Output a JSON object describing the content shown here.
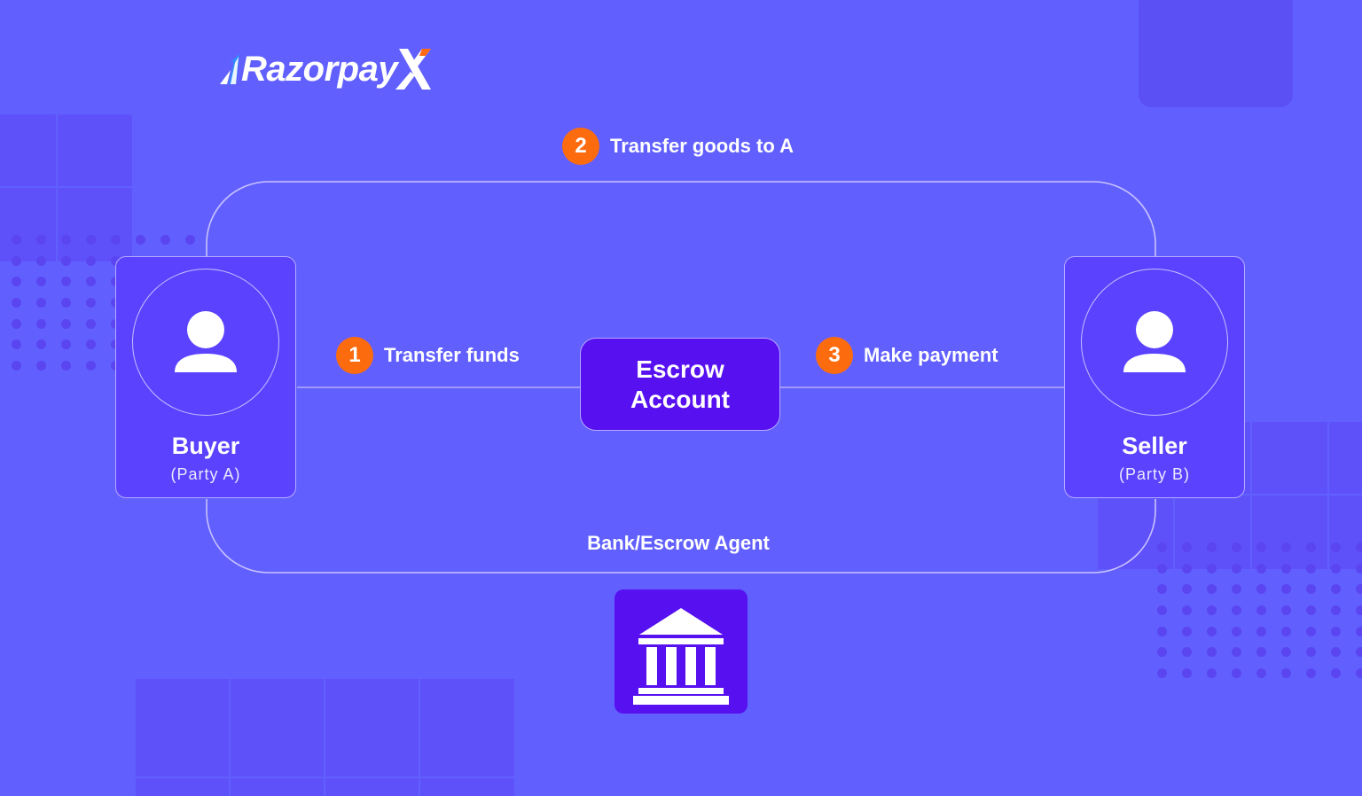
{
  "brand": {
    "name": "Razorpay",
    "suffix": "X",
    "colors": {
      "background": "#6160fe",
      "card": "#5a42ff",
      "escrow_box": "#5710ef",
      "badge": "#fd6b0f",
      "logo_accent_blue": "#2f8cff",
      "logo_accent_orange": "#ff6a13"
    }
  },
  "diagram": {
    "parties": [
      {
        "id": "buyer",
        "name": "Buyer",
        "role": "(Party A)",
        "icon": "user-icon"
      },
      {
        "id": "seller",
        "name": "Seller",
        "role": "(Party B)",
        "icon": "user-icon"
      }
    ],
    "escrow": {
      "line1": "Escrow",
      "line2": "Account"
    },
    "steps": [
      {
        "number": "1",
        "label": "Transfer funds"
      },
      {
        "number": "2",
        "label": "Transfer goods to A"
      },
      {
        "number": "3",
        "label": "Make payment"
      }
    ],
    "agent": {
      "label": "Bank/Escrow Agent",
      "icon": "bank-icon"
    }
  }
}
